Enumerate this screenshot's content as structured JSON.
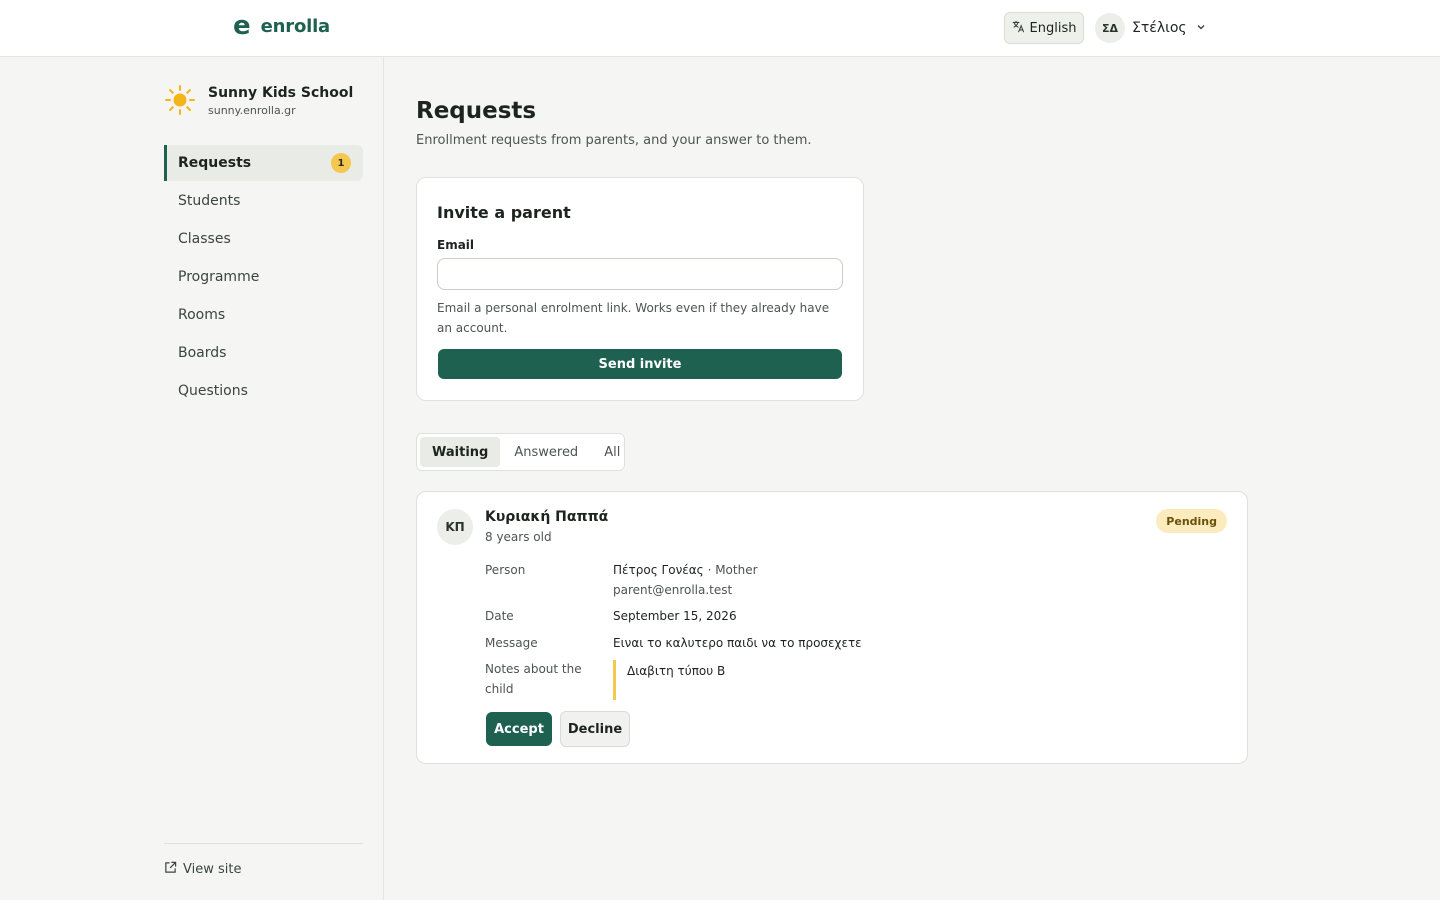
{
  "header": {
    "brand_mark": "e",
    "brand_name": "enrolla",
    "language_label": "English",
    "language_icon": "translate-icon",
    "user_initials": "ΣΔ",
    "user_name": "Στέλιος",
    "accent_color": "#1e6150"
  },
  "sidebar": {
    "school_name": "Sunny Kids School",
    "school_domain": "sunny.enrolla.gr",
    "school_icon": "sun-icon",
    "items": [
      {
        "label": "Requests",
        "active": true,
        "badge": "1"
      },
      {
        "label": "Students"
      },
      {
        "label": "Classes"
      },
      {
        "label": "Programme"
      },
      {
        "label": "Rooms"
      },
      {
        "label": "Boards"
      },
      {
        "label": "Questions"
      }
    ],
    "view_site_label": "View site",
    "view_site_icon": "external-link-icon"
  },
  "main": {
    "title": "Requests",
    "subtitle": "Enrollment requests from parents, and your answer to them.",
    "invite": {
      "title": "Invite a parent",
      "email_label": "Email",
      "email_value": "",
      "help": "Email a personal enrolment link. Works even if they already have an account.",
      "button_label": "Send invite"
    },
    "tabs": [
      {
        "label": "Waiting",
        "active": true
      },
      {
        "label": "Answered"
      },
      {
        "label": "All"
      }
    ],
    "requests": [
      {
        "initials": "ΚΠ",
        "child_name": "Κυριακή Παππά",
        "age": "8 years old",
        "status": "Pending",
        "person_label": "Person",
        "person_name": "Πέτρος Γονέας",
        "person_relation": "· Mother",
        "person_email": "parent@enrolla.test",
        "date_label": "Date",
        "date": "September 15, 2026",
        "message_label": "Message",
        "message": "Ειναι το καλυτερο παιδι να το προσεχετε",
        "notes_label": "Notes about the child",
        "notes": "Διαβιτη τύπου Β",
        "accept_label": "Accept",
        "decline_label": "Decline"
      }
    ]
  }
}
